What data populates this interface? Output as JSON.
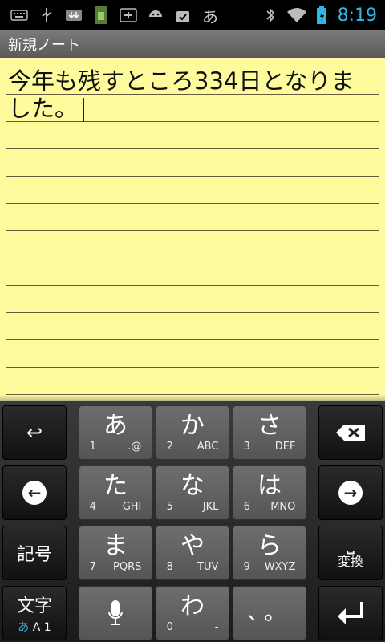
{
  "status_bar": {
    "time": "8:19",
    "icons": [
      "keyboard-icon",
      "usb-icon",
      "download-icon",
      "sd-card-icon",
      "battery-save-icon",
      "android-icon",
      "shopping-bag-icon",
      "hiragana-input-icon",
      "bluetooth-icon",
      "wifi-icon",
      "battery-icon"
    ],
    "input_indicator": "あ"
  },
  "title_bar": {
    "title": "新規ノート"
  },
  "note": {
    "text": "今年も残すところ334日となりました。"
  },
  "keyboard": {
    "undo_symbol": "↩",
    "backspace_symbol": "⌫",
    "left_symbol": "←",
    "right_symbol": "→",
    "kigou": "記号",
    "henkan": "変換",
    "space_symbol": "⎵",
    "moji": "文字",
    "mode_kana": "あ",
    "mode_alpha": "A",
    "mode_num": "1",
    "mic_symbol": "🎤",
    "enter_symbol": "↵",
    "keys": [
      {
        "kana": "あ",
        "num": "1",
        "sub": ".@"
      },
      {
        "kana": "か",
        "num": "2",
        "sub": "ABC"
      },
      {
        "kana": "さ",
        "num": "3",
        "sub": "DEF"
      },
      {
        "kana": "た",
        "num": "4",
        "sub": "GHI"
      },
      {
        "kana": "な",
        "num": "5",
        "sub": "JKL"
      },
      {
        "kana": "は",
        "num": "6",
        "sub": "MNO"
      },
      {
        "kana": "ま",
        "num": "7",
        "sub": "PQRS"
      },
      {
        "kana": "や",
        "num": "8",
        "sub": "TUV"
      },
      {
        "kana": "ら",
        "num": "9",
        "sub": "WXYZ"
      },
      {
        "kana": "わ",
        "num": "0",
        "sub": "-"
      }
    ],
    "punct": "、。"
  }
}
